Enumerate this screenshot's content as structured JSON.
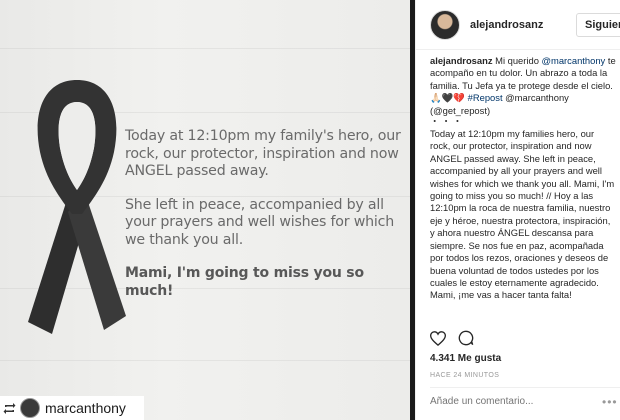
{
  "photo": {
    "paragraph1": "Today at 12:10pm my family's hero, our rock, our protector, inspiration and now ANGEL passed away.",
    "paragraph2": "She left in peace, accompanied by all your prayers and well wishes for which we thank you all.",
    "paragraph3": "Mami, I'm going to miss you so much!"
  },
  "repost_bar": {
    "username": "marcanthony"
  },
  "header": {
    "username": "alejandrosanz",
    "follow_label": "Siguiendo"
  },
  "caption": {
    "username": "alejandrosanz",
    "text_1": " Mi querido ",
    "mention_1": "@marcanthony",
    "text_2": " te acompaño en tu dolor. Un abrazo a toda la familia. Tu Jefa ya te protege desde el cielo. 🙏🏻🖤💔 ",
    "hashtag": "#Repost",
    "mention_2": " @marcanthony",
    "mention_3": "(@get_repost)",
    "dots": "・・・",
    "body": "Today at 12:10pm my families hero, our rock, our protector, inspiration and now ANGEL passed away. She left in peace, accompanied by all your prayers and well wishes for which we thank you all. Mami, I'm going to miss you so much! // Hoy a las 12:10pm la roca de nuestra familia, nuestro eje y héroe, nuestra protectora, inspiración, y ahora nuestro ÁNGEL descansa para siempre. Se nos fue en paz, acompañada por todos los rezos, oraciones y deseos de buena voluntad de todos ustedes por los cuales le estoy eternamente agradecido. Mami, ¡me vas a hacer tanta falta!"
  },
  "actions": {
    "like_icon": "heart-icon",
    "comment_icon": "comment-bubble-icon"
  },
  "likes": "4.341 Me gusta",
  "time": "HACE 24 MINUTOS",
  "comment": {
    "placeholder": "Añade un comentario...",
    "more": "•••"
  },
  "colors": {
    "link": "#003569",
    "text": "#262626",
    "muted": "#999999",
    "photo_text": "#6a6a6a"
  }
}
